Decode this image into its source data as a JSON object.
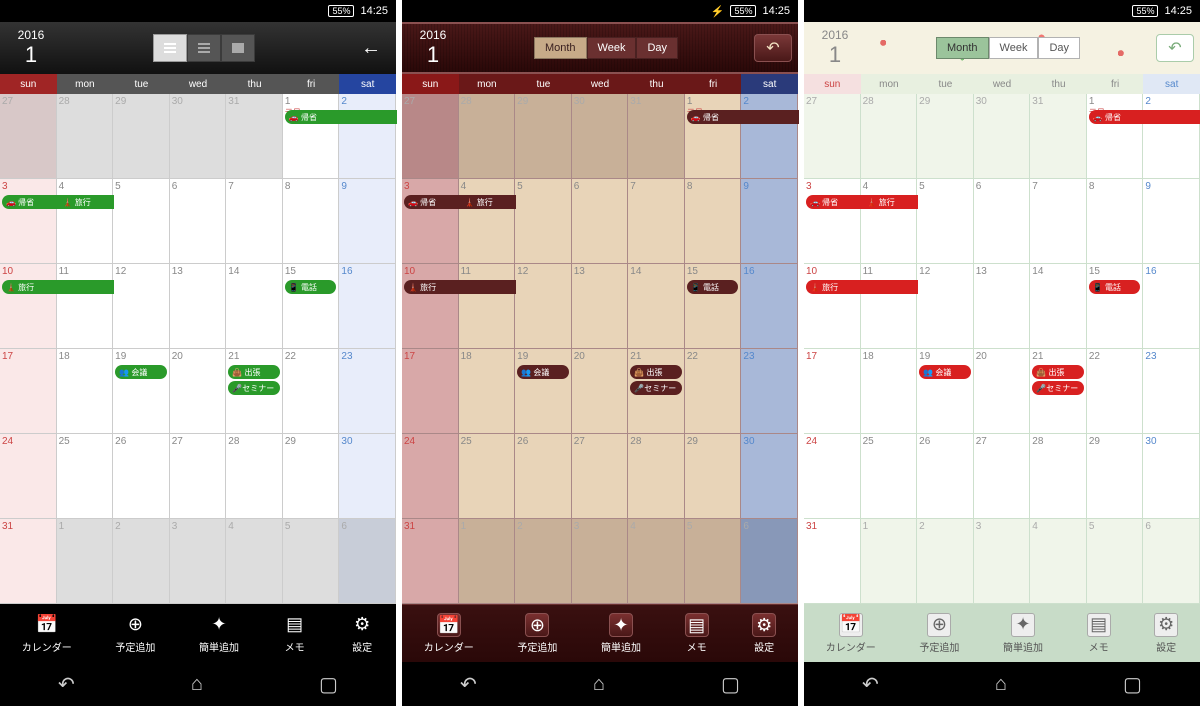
{
  "status": {
    "battery": "55%",
    "time": "14:25",
    "charging": "⚡"
  },
  "header": {
    "year": "2016",
    "month": "1"
  },
  "views": [
    "Month",
    "Week",
    "Day"
  ],
  "dow": [
    "sun",
    "mon",
    "tue",
    "wed",
    "thu",
    "fri",
    "sat"
  ],
  "toolbar": [
    {
      "icon": "📅",
      "label": "カレンダー",
      "n": "calendar"
    },
    {
      "icon": "⊕",
      "label": "予定追加",
      "n": "add-event"
    },
    {
      "icon": "✦",
      "label": "簡単追加",
      "n": "quick-add"
    },
    {
      "icon": "▤",
      "label": "メモ",
      "n": "memo"
    },
    {
      "icon": "⚙",
      "label": "設定",
      "n": "settings"
    }
  ],
  "holiday": "元日",
  "events": {
    "kisei": "🚗 帰省",
    "ryoko": "🗼 旅行",
    "denwa": "📱 電話",
    "kaigi": "👥 会議",
    "shuccho": "👜 出張",
    "seminar": "🎤セミナー"
  },
  "cells": [
    {
      "d": "27",
      "out": 1,
      "col": "sun"
    },
    {
      "d": "28",
      "out": 1
    },
    {
      "d": "29",
      "out": 1
    },
    {
      "d": "30",
      "out": 1
    },
    {
      "d": "31",
      "out": 1
    },
    {
      "d": "1",
      "hol": 1
    },
    {
      "d": "2",
      "col": "sat"
    },
    {
      "d": "3",
      "col": "sun"
    },
    {
      "d": "4"
    },
    {
      "d": "5"
    },
    {
      "d": "6"
    },
    {
      "d": "7"
    },
    {
      "d": "8"
    },
    {
      "d": "9",
      "col": "sat"
    },
    {
      "d": "10",
      "col": "sun"
    },
    {
      "d": "11"
    },
    {
      "d": "12"
    },
    {
      "d": "13"
    },
    {
      "d": "14"
    },
    {
      "d": "15"
    },
    {
      "d": "16",
      "col": "sat"
    },
    {
      "d": "17",
      "col": "sun"
    },
    {
      "d": "18"
    },
    {
      "d": "19"
    },
    {
      "d": "20"
    },
    {
      "d": "21"
    },
    {
      "d": "22"
    },
    {
      "d": "23",
      "col": "sat"
    },
    {
      "d": "24",
      "col": "sun"
    },
    {
      "d": "25"
    },
    {
      "d": "26"
    },
    {
      "d": "27"
    },
    {
      "d": "28"
    },
    {
      "d": "29"
    },
    {
      "d": "30",
      "col": "sat"
    },
    {
      "d": "31",
      "col": "sun"
    },
    {
      "d": "1",
      "out": 1
    },
    {
      "d": "2",
      "out": 1
    },
    {
      "d": "3",
      "out": 1
    },
    {
      "d": "4",
      "out": 1
    },
    {
      "d": "5",
      "out": 1
    },
    {
      "d": "6",
      "out": 1,
      "col": "sat"
    }
  ]
}
